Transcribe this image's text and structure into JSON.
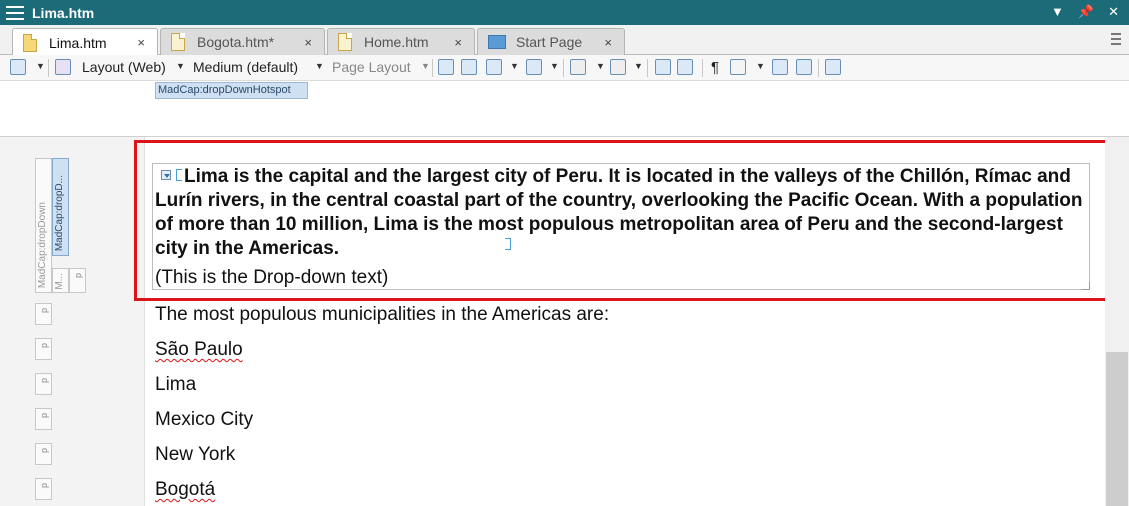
{
  "window": {
    "title": "Lima.htm"
  },
  "tabs": [
    {
      "label": "Lima.htm",
      "close": "×"
    },
    {
      "label": "Bogota.htm*",
      "close": "×"
    },
    {
      "label": "Home.htm",
      "close": "×"
    },
    {
      "label": "Start Page",
      "close": "×"
    }
  ],
  "toolbar": {
    "layout_web": "Layout (Web)",
    "medium": "Medium (default)",
    "page_layout": "Page Layout",
    "pilcrow": "¶"
  },
  "structure": {
    "hotspot_tag": "MadCap:dropDownHotspot",
    "dropdown_tag": "MadCap:dropDown",
    "dropdown_short": "MadCap:dropD...",
    "m_tag": "M...",
    "p_tag": "p"
  },
  "content": {
    "hotspot_text": "Lima is the capital and the largest city of Peru. It is located in the valleys of the Chillón, Rímac and Lurín rivers, in the central coastal part of the country, overlooking the Pacific Ocean. With a population of more than 10 million, Lima is the most populous metropolitan area of Peru and the second-largest city in the Americas.",
    "dropdown_body": "(This is the Drop-down text)",
    "intro": "The most populous municipalities in the Americas are:",
    "cities": [
      "São Paulo",
      "Lima",
      "Mexico City",
      "New York",
      "Bogotá"
    ]
  }
}
